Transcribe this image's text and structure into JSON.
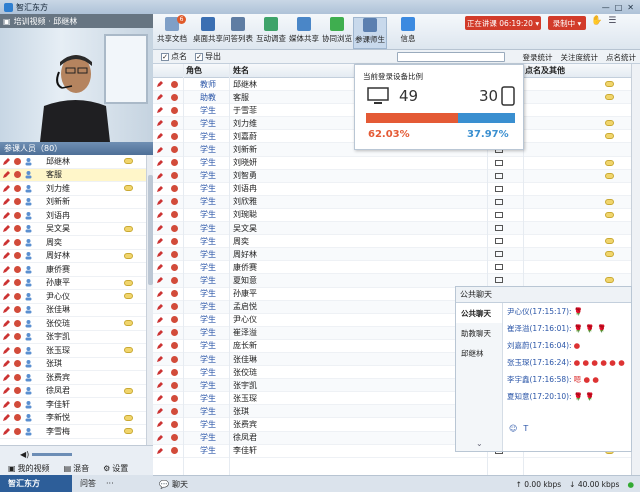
{
  "app": {
    "title": "智汇东方"
  },
  "video": {
    "header": "培训视频 · 邱继林"
  },
  "participants": {
    "header": "参课人员（80）",
    "rows": [
      {
        "name": "邱继林",
        "selected": false,
        "msg": true
      },
      {
        "name": "客服",
        "selected": true,
        "msg": false
      },
      {
        "name": "刘力维",
        "selected": false,
        "msg": true
      },
      {
        "name": "刘新新",
        "selected": false,
        "msg": false
      },
      {
        "name": "刘语冉",
        "selected": false,
        "msg": false
      },
      {
        "name": "吴文昊",
        "selected": false,
        "msg": true
      },
      {
        "name": "周奕",
        "selected": false,
        "msg": false
      },
      {
        "name": "周好林",
        "selected": false,
        "msg": true
      },
      {
        "name": "康侨赛",
        "selected": false,
        "msg": false
      },
      {
        "name": "孙康平",
        "selected": false,
        "msg": true
      },
      {
        "name": "尹心仪",
        "selected": false,
        "msg": true
      },
      {
        "name": "张佳琳",
        "selected": false,
        "msg": false
      },
      {
        "name": "张佼琏",
        "selected": false,
        "msg": true
      },
      {
        "name": "张宇凯",
        "selected": false,
        "msg": false
      },
      {
        "name": "张玉琛",
        "selected": false,
        "msg": true
      },
      {
        "name": "张琪",
        "selected": false,
        "msg": false
      },
      {
        "name": "张费宾",
        "selected": false,
        "msg": false
      },
      {
        "name": "徐凤君",
        "selected": false,
        "msg": true
      },
      {
        "name": "李佳轩",
        "selected": false,
        "msg": false
      },
      {
        "name": "李新悦",
        "selected": false,
        "msg": true
      },
      {
        "name": "李雪梅",
        "selected": false,
        "msg": true
      }
    ]
  },
  "left_bottom": {
    "my_video": "我的视频",
    "mixer": "混音",
    "settings": "设置"
  },
  "brand": "智汇东方",
  "taskbar": {
    "ask": "问答",
    "more": "···"
  },
  "toolbar": {
    "buttons": [
      {
        "label": "共享文档",
        "color": "#7f9fc7",
        "badge": "6"
      },
      {
        "label": "桌面共享",
        "color": "#3b6fb2"
      },
      {
        "label": "问答列表",
        "color": "#5f7da3"
      },
      {
        "label": "互动调查",
        "color": "#3ea36a"
      },
      {
        "label": "媒体共享",
        "color": "#4a86c7"
      },
      {
        "label": "协同浏览",
        "color": "#3fae4f"
      },
      {
        "label": "参课师生",
        "color": "#5b7fb0"
      },
      {
        "label": "信息",
        "color": "#3c8ae0"
      }
    ],
    "live": "正在讲课 06:19:20 ▾",
    "record": "录制中 ▾"
  },
  "filterbar": {
    "roll_call": "点名",
    "export": "导出",
    "login_stats": "登录统计",
    "follow_stats": "关注度统计",
    "rollcall_stats": "点名统计"
  },
  "grid": {
    "headers": {
      "role": "角色",
      "name": "姓名",
      "rollcall": "点名及其他"
    },
    "rows": [
      {
        "role": "教师",
        "name": "邱继林"
      },
      {
        "role": "助教",
        "name": "客服"
      },
      {
        "role": "学生",
        "name": "于雪菲"
      },
      {
        "role": "学生",
        "name": "刘力维"
      },
      {
        "role": "学生",
        "name": "刘嘉蔚"
      },
      {
        "role": "学生",
        "name": "刘新新"
      },
      {
        "role": "学生",
        "name": "刘晓妍"
      },
      {
        "role": "学生",
        "name": "刘智勇"
      },
      {
        "role": "学生",
        "name": "刘语冉"
      },
      {
        "role": "学生",
        "name": "刘欣雅"
      },
      {
        "role": "学生",
        "name": "刘琬聪"
      },
      {
        "role": "学生",
        "name": "吴文昊"
      },
      {
        "role": "学生",
        "name": "周奕"
      },
      {
        "role": "学生",
        "name": "周好林"
      },
      {
        "role": "学生",
        "name": "康侨赛"
      },
      {
        "role": "学生",
        "name": "夏知意"
      },
      {
        "role": "学生",
        "name": "孙康平"
      },
      {
        "role": "学生",
        "name": "孟启悦"
      },
      {
        "role": "学生",
        "name": "尹心仪"
      },
      {
        "role": "学生",
        "name": "崔泽溢"
      },
      {
        "role": "学生",
        "name": "庞长新"
      },
      {
        "role": "学生",
        "name": "张佳琳"
      },
      {
        "role": "学生",
        "name": "张佼琏"
      },
      {
        "role": "学生",
        "name": "张宇凯"
      },
      {
        "role": "学生",
        "name": "张玉琛"
      },
      {
        "role": "学生",
        "name": "张琪"
      },
      {
        "role": "学生",
        "name": "张费宾"
      },
      {
        "role": "学生",
        "name": "徐凤君"
      },
      {
        "role": "学生",
        "name": "李佳轩"
      }
    ]
  },
  "popup": {
    "title": "当前登录设备比例",
    "pc_count": "49",
    "mobile_count": "30",
    "pc_percent": "62.03%",
    "mobile_percent": "37.97%",
    "pc_fraction": 0.6203
  },
  "chat": {
    "header": "公共聊天",
    "tabs": [
      "公共聊天",
      "助教聊天",
      "邱继林"
    ],
    "messages": [
      {
        "who": "尹心仪(17:15:17):",
        "tail": "🌹"
      },
      {
        "who": "崔泽溢(17:16:01):",
        "tail": "🌹 🌹 🌹"
      },
      {
        "who": "刘嘉蔚(17:16:04):",
        "tail": "●"
      },
      {
        "who": "张玉琛(17:16:24):",
        "tail": "● ● ● ● ● ●"
      },
      {
        "who": "李宇鑫(17:16:58):",
        "tail": "嗯 ● ●"
      },
      {
        "who": "夏知意(17:20:10):",
        "tail": "🌹 🌹"
      }
    ],
    "more": "⌄"
  },
  "statusbar": {
    "chat": "聊天",
    "up": "0.00 kbps",
    "down": "40.00 kbps"
  }
}
